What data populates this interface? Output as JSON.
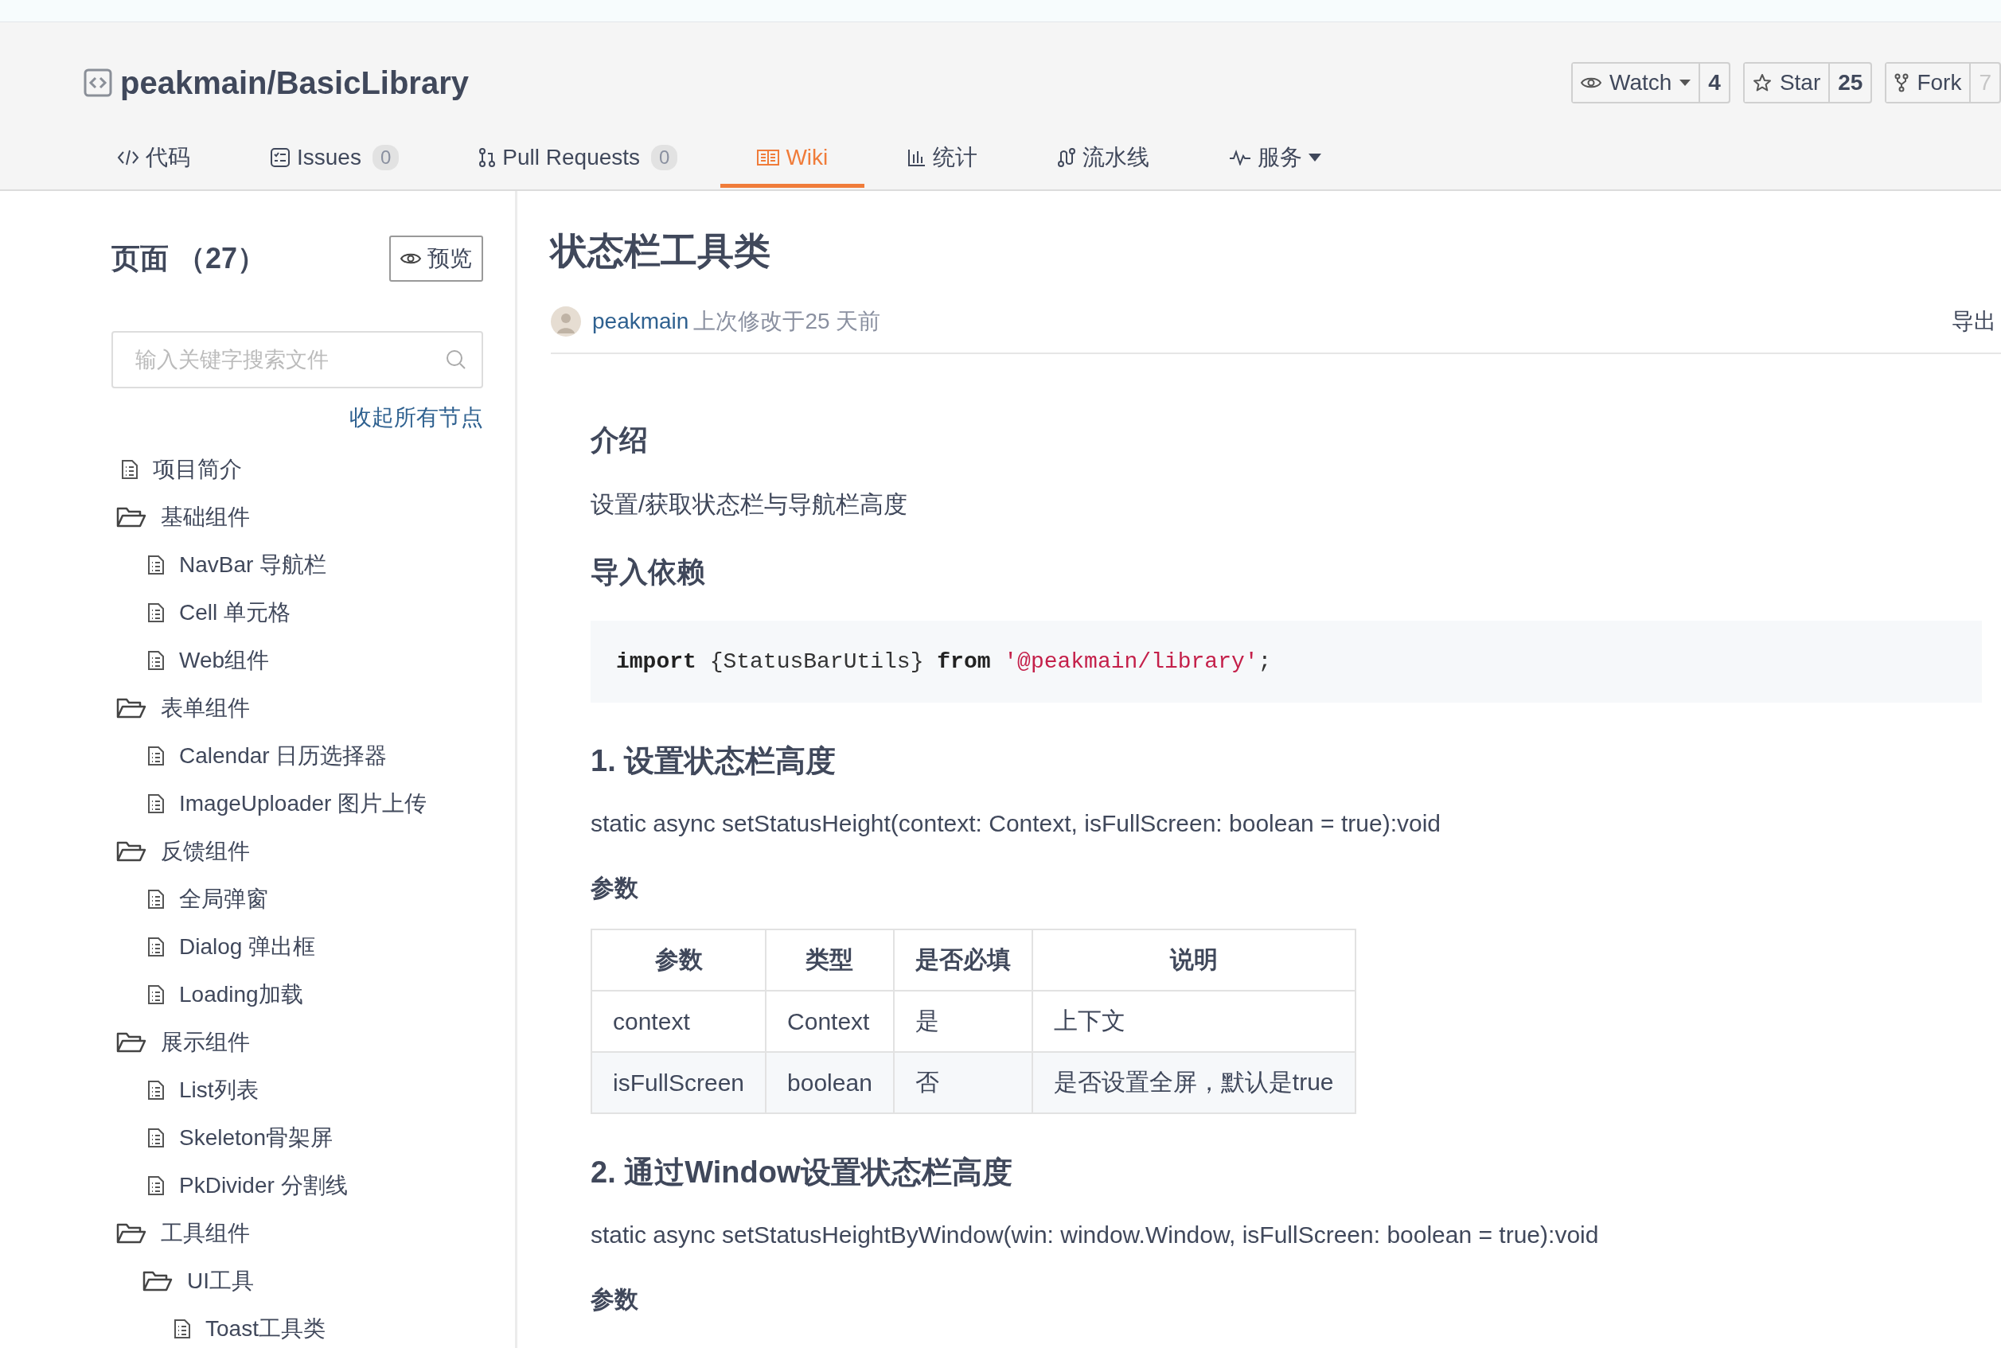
{
  "repo": {
    "title": "peakmain/BasicLibrary"
  },
  "actions": [
    {
      "kind": "watch",
      "label": "Watch",
      "dropdown": true,
      "count": "4",
      "dimmed": false
    },
    {
      "kind": "star",
      "label": "Star",
      "dropdown": false,
      "count": "25",
      "dimmed": false
    },
    {
      "kind": "fork",
      "label": "Fork",
      "dropdown": false,
      "count": "7",
      "dimmed": true
    }
  ],
  "tabs": [
    {
      "kind": "code",
      "label": "代码",
      "selected": false
    },
    {
      "kind": "issues",
      "label": "Issues",
      "count": "0",
      "selected": false
    },
    {
      "kind": "pr",
      "label": "Pull Requests",
      "count": "0",
      "selected": false
    },
    {
      "kind": "wiki",
      "label": "Wiki",
      "selected": true
    },
    {
      "kind": "stats",
      "label": "统计",
      "selected": false
    },
    {
      "kind": "pipeline",
      "label": "流水线",
      "selected": false
    },
    {
      "kind": "service",
      "label": "服务",
      "dropdown": true,
      "selected": false
    }
  ],
  "sidebar": {
    "title": "页面 （27）",
    "preview_button": "预览",
    "search": {
      "placeholder": "输入关键字搜索文件"
    },
    "collapse_link": "收起所有节点",
    "tree": [
      {
        "kind": "page",
        "label": "项目简介"
      },
      {
        "kind": "folder",
        "label": "基础组件",
        "children": [
          {
            "kind": "page",
            "label": "NavBar 导航栏"
          },
          {
            "kind": "page",
            "label": "Cell 单元格"
          },
          {
            "kind": "page",
            "label": "Web组件"
          }
        ]
      },
      {
        "kind": "folder",
        "label": "表单组件",
        "children": [
          {
            "kind": "page",
            "label": "Calendar 日历选择器"
          },
          {
            "kind": "page",
            "label": "ImageUploader 图片上传"
          }
        ]
      },
      {
        "kind": "folder",
        "label": "反馈组件",
        "children": [
          {
            "kind": "page",
            "label": "全局弹窗"
          },
          {
            "kind": "page",
            "label": "Dialog 弹出框"
          },
          {
            "kind": "page",
            "label": "Loading加载"
          }
        ]
      },
      {
        "kind": "folder",
        "label": "展示组件",
        "children": [
          {
            "kind": "page",
            "label": "List列表"
          },
          {
            "kind": "page",
            "label": "Skeleton骨架屏"
          },
          {
            "kind": "page",
            "label": "PkDivider 分割线"
          }
        ]
      },
      {
        "kind": "folder",
        "label": "工具组件",
        "children": [
          {
            "kind": "folder",
            "label": "UI工具",
            "children": [
              {
                "kind": "page",
                "label": "Toast工具类"
              }
            ]
          }
        ]
      }
    ]
  },
  "article": {
    "title": "状态栏工具类",
    "author": "peakmain",
    "modified": "上次修改于25 天前",
    "export_link": "导出",
    "blocks": [
      {
        "kind": "h2",
        "text": "介绍"
      },
      {
        "kind": "p",
        "text": "设置/获取状态栏与导航栏高度"
      },
      {
        "kind": "h2",
        "text": "导入依赖"
      },
      {
        "kind": "code",
        "tokens": [
          {
            "kind": "keyword",
            "text": "import"
          },
          {
            "kind": "plain",
            "text": " {StatusBarUtils} "
          },
          {
            "kind": "keyword",
            "text": "from"
          },
          {
            "kind": "string",
            "text": " '@peakmain/library'"
          },
          {
            "kind": "plain",
            "text": ";"
          }
        ]
      },
      {
        "kind": "h3",
        "text": "1. 设置状态栏高度"
      },
      {
        "kind": "p",
        "text": "static async setStatusHeight(context: Context, isFullScreen: boolean = true):void"
      },
      {
        "kind": "h4",
        "text": "参数"
      },
      {
        "kind": "table",
        "columns": [
          "参数",
          "类型",
          "是否必填",
          "说明"
        ],
        "rows": [
          [
            "context",
            "Context",
            "是",
            "上下文"
          ],
          [
            "isFullScreen",
            "boolean",
            "否",
            "是否设置全屏，默认是true"
          ]
        ]
      },
      {
        "kind": "h3",
        "text": "2. 通过Window设置状态栏高度"
      },
      {
        "kind": "p",
        "text": "static async setStatusHeightByWindow(win: window.Window, isFullScreen: boolean = true):void"
      },
      {
        "kind": "h4",
        "text": "参数"
      }
    ]
  }
}
